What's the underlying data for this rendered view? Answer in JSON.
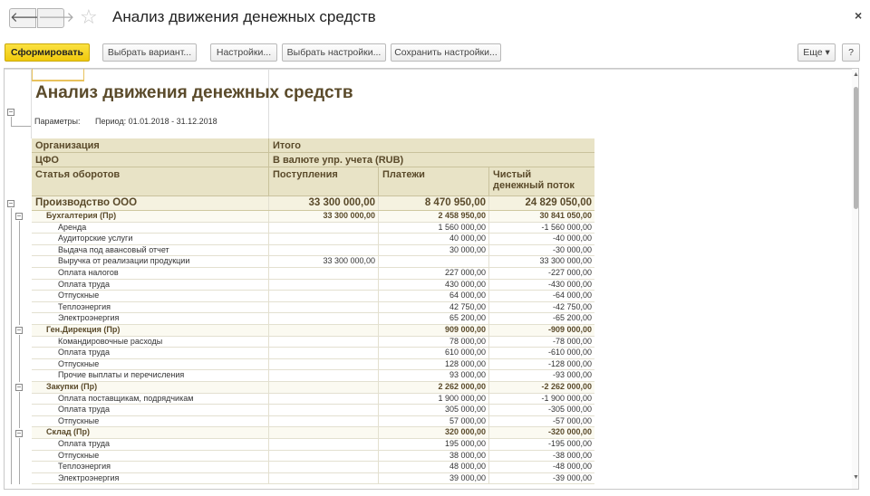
{
  "window": {
    "back_glyph": "🡐",
    "forward_glyph": "🡒",
    "star_glyph": "☆",
    "title": "Анализ движения денежных средств",
    "close_glyph": "×"
  },
  "toolbar": {
    "generate": "Сформировать",
    "choose_variant": "Выбрать вариант...",
    "settings": "Настройки...",
    "choose_settings": "Выбрать настройки...",
    "save_settings": "Сохранить настройки...",
    "more": "Еще ▾",
    "help": "?"
  },
  "report": {
    "title": "Анализ движения денежных средств",
    "params_label": "Параметры:",
    "period": "Период: 01.01.2018 - 31.12.2018",
    "header": {
      "org_label": "Организация",
      "org_value": "Итого",
      "cfo_label": "ЦФО",
      "cfo_value": "В валюте упр. учета (RUB)",
      "article_label": "Статья оборотов",
      "income": "Поступления",
      "payments": "Платежи",
      "net_line1": "Чистый",
      "net_line2": "денежный поток"
    },
    "rows": [
      {
        "level": 1,
        "name": "Производство ООО",
        "income": "33 300 000,00",
        "payments": "8 470 950,00",
        "net": "24 829 050,00"
      },
      {
        "level": 2,
        "name": "Бухгалтерия (Пр)",
        "income": "33 300 000,00",
        "payments": "2 458 950,00",
        "net": "30 841 050,00"
      },
      {
        "level": 3,
        "name": "Аренда",
        "income": "",
        "payments": "1 560 000,00",
        "net": "-1 560 000,00"
      },
      {
        "level": 3,
        "name": "Аудиторские услуги",
        "income": "",
        "payments": "40 000,00",
        "net": "-40 000,00"
      },
      {
        "level": 3,
        "name": "Выдача под авансовый отчет",
        "income": "",
        "payments": "30 000,00",
        "net": "-30 000,00"
      },
      {
        "level": 3,
        "name": "Выручка от реализации продукции",
        "income": "33 300 000,00",
        "payments": "",
        "net": "33 300 000,00"
      },
      {
        "level": 3,
        "name": "Оплата налогов",
        "income": "",
        "payments": "227 000,00",
        "net": "-227 000,00"
      },
      {
        "level": 3,
        "name": "Оплата труда",
        "income": "",
        "payments": "430 000,00",
        "net": "-430 000,00"
      },
      {
        "level": 3,
        "name": "Отпускные",
        "income": "",
        "payments": "64 000,00",
        "net": "-64 000,00"
      },
      {
        "level": 3,
        "name": "Теплоэнергия",
        "income": "",
        "payments": "42 750,00",
        "net": "-42 750,00"
      },
      {
        "level": 3,
        "name": "Электроэнергия",
        "income": "",
        "payments": "65 200,00",
        "net": "-65 200,00"
      },
      {
        "level": 2,
        "name": "Ген.Дирекция (Пр)",
        "income": "",
        "payments": "909 000,00",
        "net": "-909 000,00"
      },
      {
        "level": 3,
        "name": "Командировочные расходы",
        "income": "",
        "payments": "78 000,00",
        "net": "-78 000,00"
      },
      {
        "level": 3,
        "name": "Оплата труда",
        "income": "",
        "payments": "610 000,00",
        "net": "-610 000,00"
      },
      {
        "level": 3,
        "name": "Отпускные",
        "income": "",
        "payments": "128 000,00",
        "net": "-128 000,00"
      },
      {
        "level": 3,
        "name": "Прочие выплаты и перечисления",
        "income": "",
        "payments": "93 000,00",
        "net": "-93 000,00"
      },
      {
        "level": 2,
        "name": "Закупки (Пр)",
        "income": "",
        "payments": "2 262 000,00",
        "net": "-2 262 000,00"
      },
      {
        "level": 3,
        "name": "Оплата поставщикам, подрядчикам",
        "income": "",
        "payments": "1 900 000,00",
        "net": "-1 900 000,00"
      },
      {
        "level": 3,
        "name": "Оплата труда",
        "income": "",
        "payments": "305 000,00",
        "net": "-305 000,00"
      },
      {
        "level": 3,
        "name": "Отпускные",
        "income": "",
        "payments": "57 000,00",
        "net": "-57 000,00"
      },
      {
        "level": 2,
        "name": "Склад (Пр)",
        "income": "",
        "payments": "320 000,00",
        "net": "-320 000,00"
      },
      {
        "level": 3,
        "name": "Оплата труда",
        "income": "",
        "payments": "195 000,00",
        "net": "-195 000,00"
      },
      {
        "level": 3,
        "name": "Отпускные",
        "income": "",
        "payments": "38 000,00",
        "net": "-38 000,00"
      },
      {
        "level": 3,
        "name": "Теплоэнергия",
        "income": "",
        "payments": "48 000,00",
        "net": "-48 000,00"
      },
      {
        "level": 3,
        "name": "Электроэнергия",
        "income": "",
        "payments": "39 000,00",
        "net": "-39 000,00"
      }
    ]
  },
  "colors": {
    "accent": "#f0c90b",
    "header_bg": "#e8e3c6",
    "title_text": "#5a4a2a"
  },
  "icons": [
    "back-arrow-icon",
    "forward-arrow-icon",
    "favorite-star-icon",
    "close-icon",
    "collapse-icon",
    "scroll-up-icon",
    "scroll-down-icon"
  ]
}
